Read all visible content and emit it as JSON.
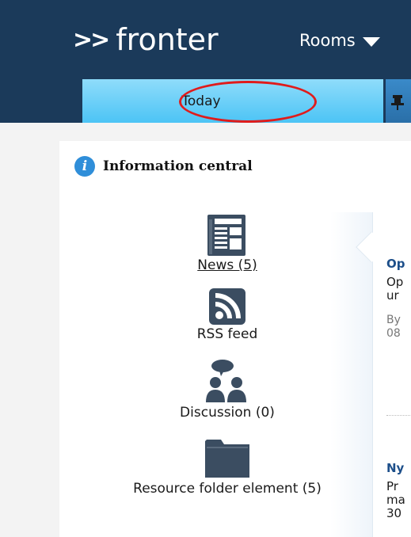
{
  "header": {
    "logo_arrows": ">>",
    "logo_text": "fronter",
    "rooms_menu_label": "Rooms"
  },
  "tabs": {
    "today_label": "Today"
  },
  "info_central": {
    "icon_glyph": "i",
    "title": "Information central"
  },
  "elements": [
    {
      "label": "News (5)",
      "icon": "news-icon"
    },
    {
      "label": "RSS feed",
      "icon": "rss-icon"
    },
    {
      "label": "Discussion (0)",
      "icon": "discussion-icon"
    },
    {
      "label": "Resource folder element (5)",
      "icon": "folder-icon"
    }
  ],
  "feed": {
    "item1": {
      "title": "Op",
      "text_line1": "Op",
      "text_line2": "ur",
      "meta_line1": "By",
      "meta_line2": "08"
    },
    "item2": {
      "title": "Ny",
      "text_line1": "Pr",
      "text_line2": "ma",
      "text_line3": "30"
    }
  },
  "colors": {
    "topbar": "#1b3a5a",
    "tab_today": "#4cc4f5",
    "annotation": "#e01b1b",
    "info_icon": "#2f8ed9",
    "element_icon": "#3b4d61"
  }
}
